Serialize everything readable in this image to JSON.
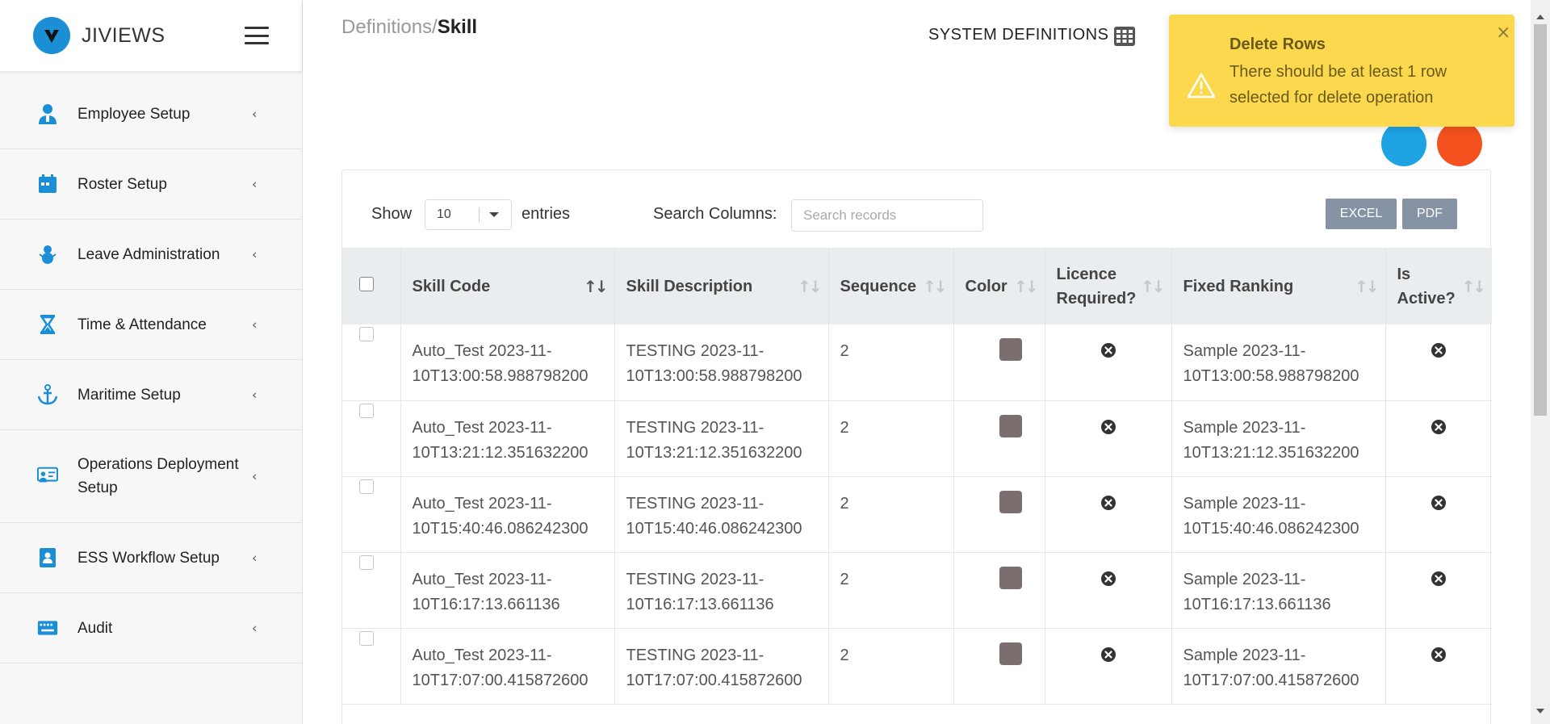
{
  "brand": {
    "name": "JIVIEWS"
  },
  "sidebar": {
    "items": [
      {
        "label": "Employee Setup",
        "icon": "employee-icon"
      },
      {
        "label": "Roster Setup",
        "icon": "calendar-icon"
      },
      {
        "label": "Leave Administration",
        "icon": "snowman-icon"
      },
      {
        "label": "Time & Attendance",
        "icon": "hourglass-icon"
      },
      {
        "label": "Maritime Setup",
        "icon": "anchor-icon"
      },
      {
        "label": "Operations Deployment Setup",
        "icon": "deployment-icon"
      },
      {
        "label": "ESS Workflow Setup",
        "icon": "badge-icon"
      },
      {
        "label": "Audit",
        "icon": "keyboard-icon"
      }
    ]
  },
  "header": {
    "breadcrumb_parent": "Definitions/",
    "breadcrumb_current": "Skill",
    "system_definitions": "SYSTEM DEFINITIONS"
  },
  "toolbar": {
    "show_label": "Show",
    "entries_value": "10",
    "entries_label": "entries",
    "search_label": "Search Columns:",
    "search_placeholder": "Search records",
    "excel_label": "EXCEL",
    "pdf_label": "PDF"
  },
  "table": {
    "headers": {
      "skill_code": "Skill Code",
      "skill_description": "Skill Description",
      "sequence": "Sequence",
      "color": "Color",
      "licence_required": "Licence Required?",
      "fixed_ranking": "Fixed Ranking",
      "is_active": "Is Active?"
    },
    "rows": [
      {
        "code": "Auto_Test 2023-11-10T13:00:58.988798200",
        "description": "TESTING 2023-11-10T13:00:58.988798200",
        "sequence": "2",
        "color": "#7a6e6e",
        "ranking": "Sample 2023-11-10T13:00:58.988798200"
      },
      {
        "code": "Auto_Test 2023-11-10T13:21:12.351632200",
        "description": "TESTING 2023-11-10T13:21:12.351632200",
        "sequence": "2",
        "color": "#7a6e6e",
        "ranking": "Sample 2023-11-10T13:21:12.351632200"
      },
      {
        "code": "Auto_Test 2023-11-10T15:40:46.086242300",
        "description": "TESTING 2023-11-10T15:40:46.086242300",
        "sequence": "2",
        "color": "#7a6e6e",
        "ranking": "Sample 2023-11-10T15:40:46.086242300"
      },
      {
        "code": "Auto_Test 2023-11-10T16:17:13.661136",
        "description": "TESTING 2023-11-10T16:17:13.661136",
        "sequence": "2",
        "color": "#7a6e6e",
        "ranking": "Sample 2023-11-10T16:17:13.661136"
      },
      {
        "code": "Auto_Test 2023-11-10T17:07:00.415872600",
        "description": "TESTING 2023-11-10T17:07:00.415872600",
        "sequence": "2",
        "color": "#7a6e6e",
        "ranking": "Sample 2023-11-10T17:07:00.415872600"
      }
    ]
  },
  "toast": {
    "title": "Delete Rows",
    "message": "There should be at least 1 row selected for delete operation",
    "close": "×"
  },
  "colors": {
    "accent": "#1a8fd6",
    "toast_bg": "#fcd84f",
    "button_gray": "#8593a5",
    "fab_blue": "#1ea3e3",
    "fab_red": "#f4511e"
  }
}
